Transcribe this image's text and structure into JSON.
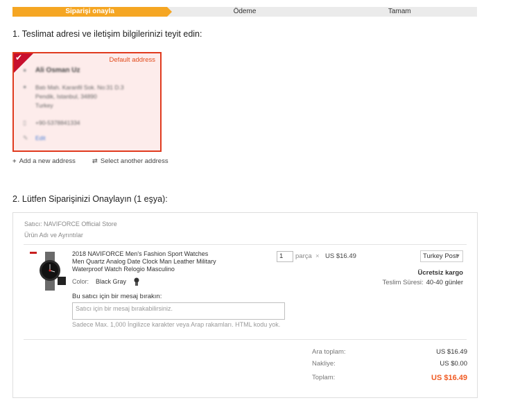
{
  "steps": [
    {
      "label": "Siparişi onayla",
      "active": true
    },
    {
      "label": "Ödeme",
      "active": false
    },
    {
      "label": "Tamam",
      "active": false
    }
  ],
  "section1_title": "1. Teslimat adresi ve iletişim bilgilerinizi teyit edin:",
  "address": {
    "default_label": "Default address",
    "name": "Ali Osman Uz",
    "line1": "Batı Mah. Karanfil Sok. No:31 D.3",
    "line2": "Pendik, Istanbul, 34890",
    "line3": "Turkey",
    "phone": "+90-5378841334",
    "edit_label": "Edit"
  },
  "address_actions": {
    "add_label": "Add a new address",
    "select_label": "Select another address"
  },
  "section2_title": "2. Lütfen Siparişinizi Onaylayın (1 eşya):",
  "order": {
    "seller": "Satıcı: NAVIFORCE Official Store",
    "columns_label": "Ürün Adı ve Ayrıntılar",
    "product_title": "2018 NAVIFORCE Men's Fashion Sport Watches Men Quartz Analog Date Clock Man Leather Military Waterproof Watch Relogio Masculino",
    "color_label": "Color:",
    "color_value": "Black Gray",
    "quantity": "1",
    "quantity_unit": "parça",
    "times": "×",
    "unit_price": "US $16.49",
    "shipping_method": "Turkey Post",
    "free_shipping": "Ücretsiz kargo",
    "delivery_label": "Teslim Süresi:",
    "delivery_value": "40-40 günler",
    "message_label": "Bu satıcı için bir mesaj bırakın:",
    "message_placeholder": "Satıcı için bir mesaj bırakabilirsiniz.",
    "message_hint": "Sadece Max. 1,000 İngilizce karakter veya Arap rakamları. HTML kodu yok."
  },
  "summary": {
    "subtotal_label": "Ara toplam:",
    "subtotal_value": "US $16.49",
    "shipping_label": "Nakliye:",
    "shipping_value": "US $0.00",
    "total_label": "Toplam:",
    "total_value": "US $16.49"
  },
  "colors": {
    "accent": "#f5a623",
    "card_border": "#e03a1e",
    "total": "#f05a22"
  }
}
